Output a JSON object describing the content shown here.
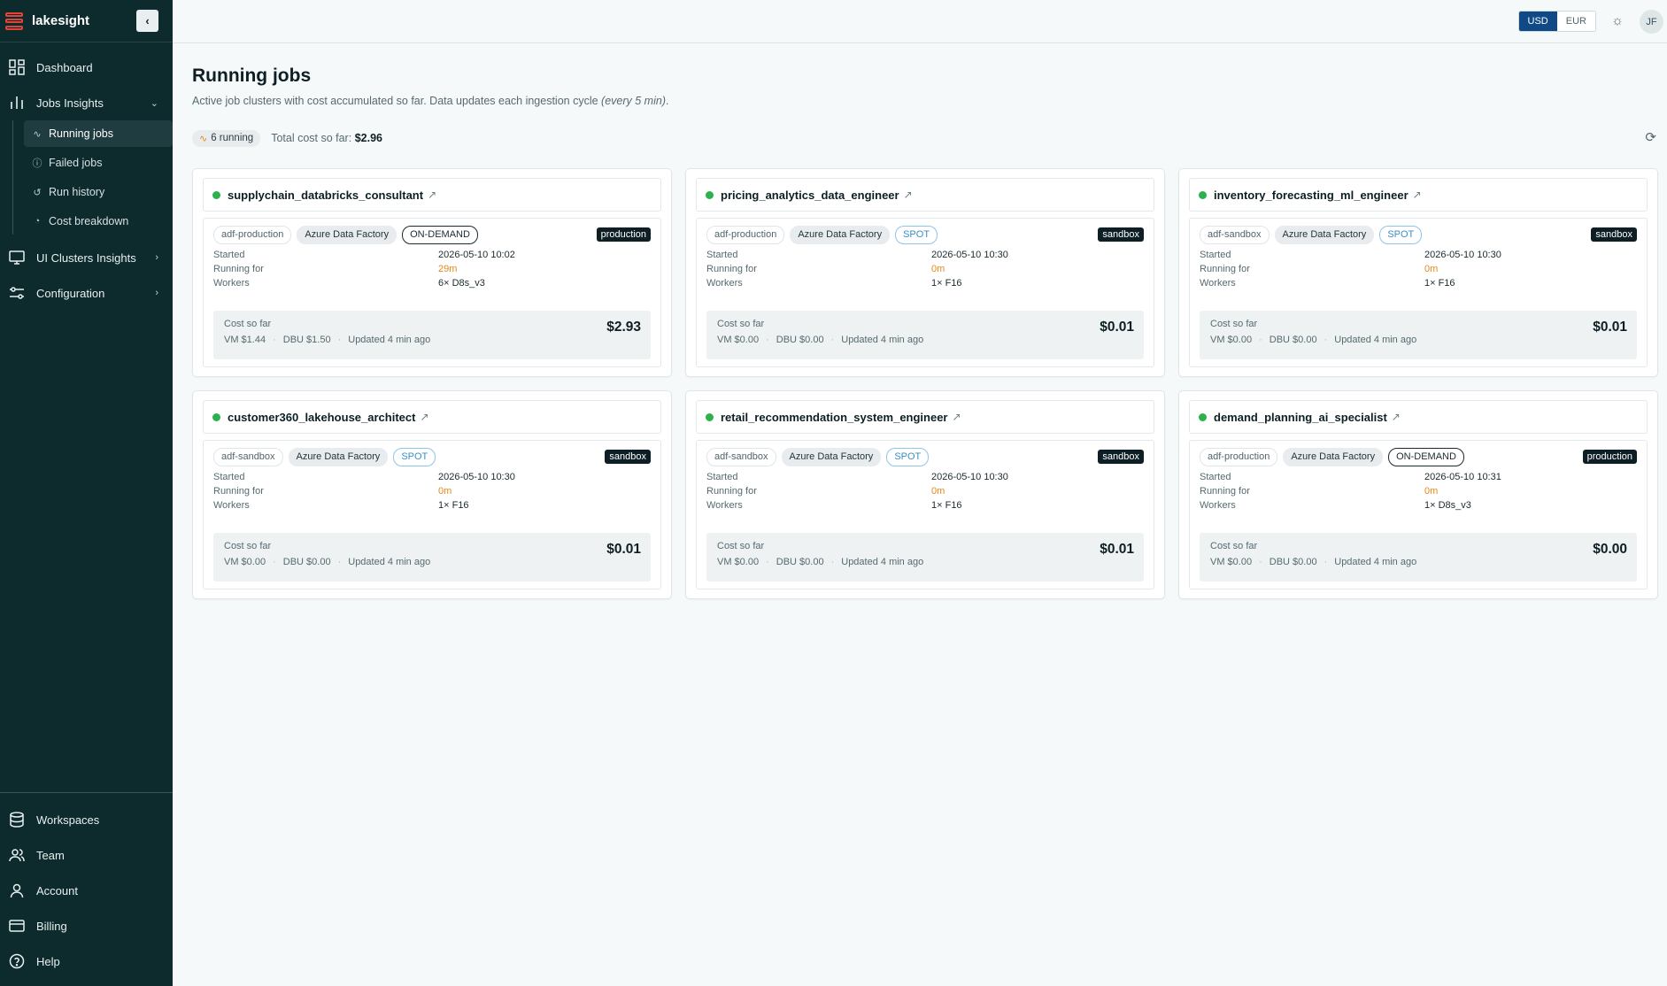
{
  "app": {
    "name": "lakesight"
  },
  "sidebar": {
    "items": [
      {
        "label": "Dashboard"
      },
      {
        "label": "Jobs Insights"
      },
      {
        "label": "UI Clusters Insights"
      },
      {
        "label": "Configuration"
      }
    ],
    "sub_items": [
      {
        "label": "Running jobs",
        "icon": "activity-icon"
      },
      {
        "label": "Failed jobs",
        "icon": "alert-circle-icon"
      },
      {
        "label": "Run history",
        "icon": "history-icon"
      },
      {
        "label": "Cost breakdown",
        "icon": "pie-chart-icon"
      }
    ],
    "bottom_items": [
      {
        "label": "Workspaces"
      },
      {
        "label": "Team"
      },
      {
        "label": "Account"
      },
      {
        "label": "Billing"
      },
      {
        "label": "Help"
      }
    ]
  },
  "topbar": {
    "currencies": [
      "USD",
      "EUR"
    ],
    "selected_currency": "USD",
    "avatar_initials": "JF"
  },
  "page": {
    "title": "Running jobs",
    "subtitle_prefix": "Active job clusters with cost accumulated so far. Data updates each ingestion cycle ",
    "subtitle_em": "(every 5 min)",
    "subtitle_suffix": ".",
    "running_badge": "6 running",
    "total_cost_label": "Total cost so far:",
    "total_cost_value": "$2.96"
  },
  "labels": {
    "started": "Started",
    "running_for": "Running for",
    "workers": "Workers",
    "cost_so_far": "Cost so far"
  },
  "jobs": [
    {
      "name": "supplychain_databricks_consultant",
      "workspace": "adf-production",
      "source": "Azure Data Factory",
      "pricing": "ON-DEMAND",
      "env": "production",
      "started": "2026-05-10 10:02",
      "running_for": "29m",
      "workers": "6× D8s_v3",
      "cost": "$2.93",
      "vm": "VM $1.44",
      "dbu": "DBU $1.50",
      "updated": "Updated 4 min ago"
    },
    {
      "name": "pricing_analytics_data_engineer",
      "workspace": "adf-production",
      "source": "Azure Data Factory",
      "pricing": "SPOT",
      "env": "sandbox",
      "started": "2026-05-10 10:30",
      "running_for": "0m",
      "workers": "1× F16",
      "cost": "$0.01",
      "vm": "VM $0.00",
      "dbu": "DBU $0.00",
      "updated": "Updated 4 min ago"
    },
    {
      "name": "inventory_forecasting_ml_engineer",
      "workspace": "adf-sandbox",
      "source": "Azure Data Factory",
      "pricing": "SPOT",
      "env": "sandbox",
      "started": "2026-05-10 10:30",
      "running_for": "0m",
      "workers": "1× F16",
      "cost": "$0.01",
      "vm": "VM $0.00",
      "dbu": "DBU $0.00",
      "updated": "Updated 4 min ago"
    },
    {
      "name": "customer360_lakehouse_architect",
      "workspace": "adf-sandbox",
      "source": "Azure Data Factory",
      "pricing": "SPOT",
      "env": "sandbox",
      "started": "2026-05-10 10:30",
      "running_for": "0m",
      "workers": "1× F16",
      "cost": "$0.01",
      "vm": "VM $0.00",
      "dbu": "DBU $0.00",
      "updated": "Updated 4 min ago"
    },
    {
      "name": "retail_recommendation_system_engineer",
      "workspace": "adf-sandbox",
      "source": "Azure Data Factory",
      "pricing": "SPOT",
      "env": "sandbox",
      "started": "2026-05-10 10:30",
      "running_for": "0m",
      "workers": "1× F16",
      "cost": "$0.01",
      "vm": "VM $0.00",
      "dbu": "DBU $0.00",
      "updated": "Updated 4 min ago"
    },
    {
      "name": "demand_planning_ai_specialist",
      "workspace": "adf-production",
      "source": "Azure Data Factory",
      "pricing": "ON-DEMAND",
      "env": "production",
      "started": "2026-05-10 10:31",
      "running_for": "0m",
      "workers": "1× D8s_v3",
      "cost": "$0.00",
      "vm": "VM $0.00",
      "dbu": "DBU $0.00",
      "updated": "Updated 4 min ago"
    }
  ],
  "colors": {
    "sidebar_bg": "#0d2a2d",
    "accent_blue": "#0f4a86",
    "running_green": "#2bb24c",
    "duration_orange": "#e6881a",
    "logo_red": "#e0453a"
  }
}
